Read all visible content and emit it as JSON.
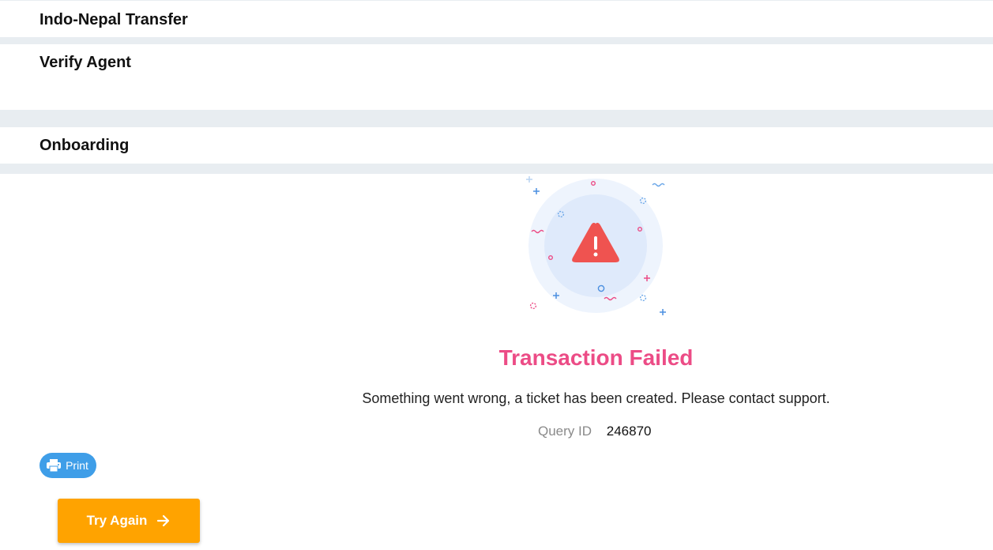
{
  "sections": [
    {
      "title": "Indo-Nepal Transfer"
    },
    {
      "title": "Verify Agent"
    },
    {
      "title": "Onboarding"
    }
  ],
  "result": {
    "title": "Transaction Failed",
    "message": "Something went wrong, a ticket has been created. Please contact support.",
    "query_label": "Query ID",
    "query_id": "246870"
  },
  "actions": {
    "print_label": "Print",
    "print_icon": "printer-icon",
    "retry_label": "Try Again",
    "retry_icon": "arrow-right-icon"
  },
  "illustration": {
    "icon": "warning-triangle-icon"
  },
  "colors": {
    "band": "#e8edf1",
    "title": "#ec4c86",
    "warning": "#ef5350",
    "print_button": "#3f9ee8",
    "retry_button": "#ffa300"
  }
}
